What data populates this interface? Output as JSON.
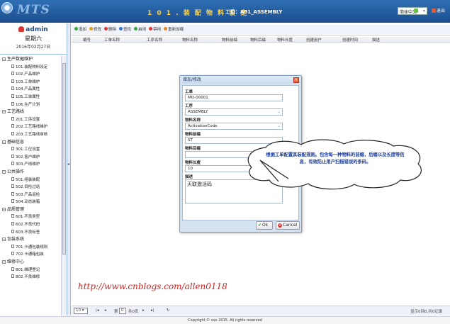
{
  "header": {
    "logo_text": "MTS",
    "title": "1 0 1 . 装 配 物 料 设 定",
    "station": "工位：A01_ASSEMBLY",
    "language": "简体中文",
    "fullscreen_label": "全屏",
    "exit_label": "退出"
  },
  "user": {
    "name": "admin",
    "weekday": "星期六",
    "date": "2016年02月27日"
  },
  "tree": {
    "groups": [
      {
        "label": "生产数据维护",
        "items": [
          "101.装配物料设定",
          "102.产品维护",
          "103.工单维护",
          "104.产品属性",
          "105.工单属性",
          "106.生产计划"
        ]
      },
      {
        "label": "工艺路线",
        "items": [
          "201.工序设置",
          "202.工艺路线维护",
          "203.工艺路线审核"
        ]
      },
      {
        "label": "基础信息",
        "items": [
          "301.工位设置",
          "302.客户维护",
          "303.产线维护"
        ]
      },
      {
        "label": "公共操作",
        "items": [
          "501.组装装配",
          "502.目检过站",
          "503.产品返检",
          "504.动态装箱"
        ]
      },
      {
        "label": "品质管理",
        "items": [
          "601.不良类型",
          "602.不良代码",
          "603.不良标签"
        ]
      },
      {
        "label": "包装系统",
        "items": [
          "701.卡通包装规则",
          "702.卡通箱包装"
        ]
      },
      {
        "label": "维修中心",
        "items": [
          "801.维理登记",
          "802.不良维修"
        ]
      }
    ]
  },
  "toolbar": {
    "buttons": [
      "增加",
      "修改",
      "删除",
      "查找",
      "启用",
      "禁用",
      "重新加载"
    ]
  },
  "grid": {
    "columns": [
      "编号",
      "工单名称",
      "工序名称",
      "物料名称",
      "物料前缀",
      "物料后缀",
      "物料长度",
      "创建用户",
      "创建时间",
      "描述"
    ]
  },
  "pager": {
    "page_size": "10",
    "page_label": "第",
    "page_value": "0",
    "total_pages": "共0页",
    "summary": "显示0到0,共0记录"
  },
  "footer": {
    "copyright": "Copyright © xxx 2015. All rights reserved"
  },
  "watermark": "http://www.cnblogs.com/allen0118",
  "dialog": {
    "title": "增加/修改",
    "fields": {
      "workorder_label": "工单",
      "workorder_value": "MO-00001",
      "process_label": "工序",
      "process_value": "ASSEMBLY",
      "material_label": "物料名称",
      "material_value": "ActivationCode",
      "prefix_label": "物料前缀",
      "prefix_value": "ST",
      "suffix_label": "物料后缀",
      "suffix_value": "",
      "length_label": "物料长度",
      "length_value": "10",
      "desc_label": "描述",
      "desc_value": "天联激活码"
    },
    "ok_label": "Ok",
    "cancel_label": "Cancel"
  },
  "callout": {
    "text": "根据工单配置其装配规则。包含每一种物料的前缀，后缀以及长度等信息，有效防止用户扫描错误的条码。"
  }
}
